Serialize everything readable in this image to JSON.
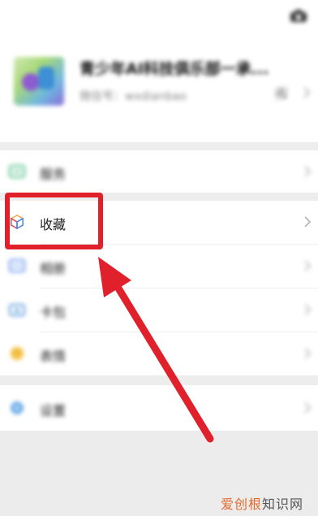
{
  "profile": {
    "nickname": "青少年AI科技俱乐部一承...",
    "wechat_id": "微信号：wxdianbao"
  },
  "menu": {
    "services": {
      "label": "服务",
      "icon": "services-icon"
    },
    "favorites": {
      "label": "收藏",
      "icon": "favorites-cube-icon"
    },
    "moments": {
      "label": "相册",
      "icon": "album-icon"
    },
    "cards": {
      "label": "卡包",
      "icon": "card-wallet-icon"
    },
    "stickers": {
      "label": "表情",
      "icon": "sticker-icon"
    },
    "settings": {
      "label": "设置",
      "icon": "settings-gear-icon"
    }
  },
  "annotation": {
    "color": "#e0212c"
  },
  "watermark": {
    "part1": "爱创根",
    "part2": "知识网"
  }
}
